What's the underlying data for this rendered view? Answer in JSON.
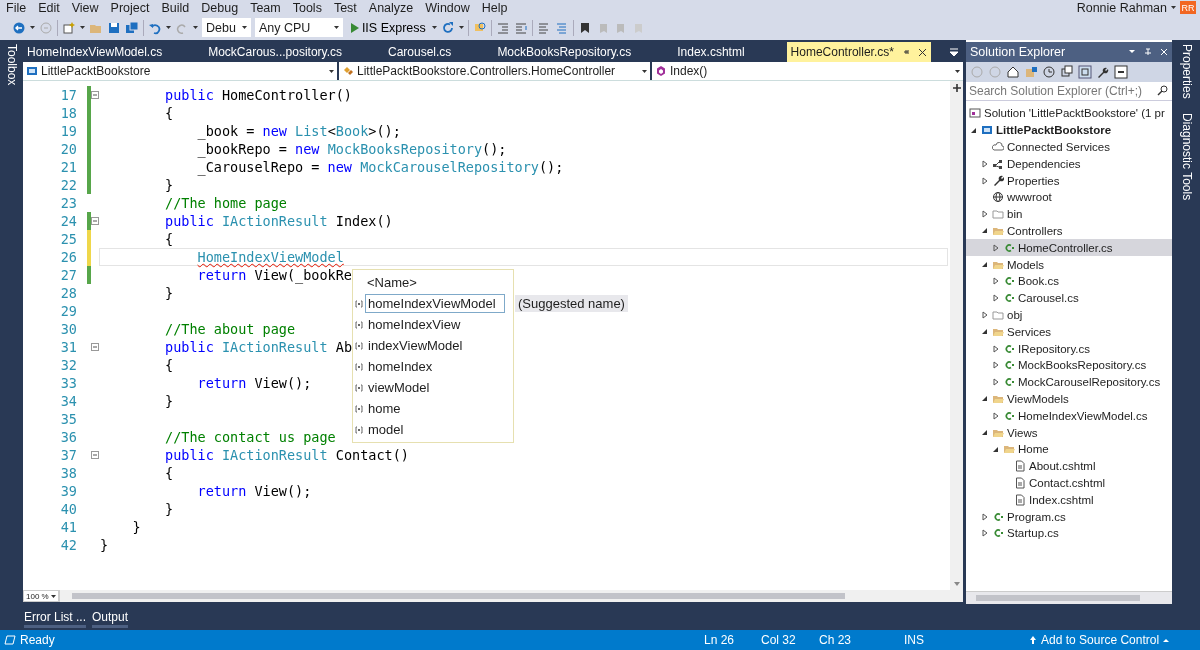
{
  "menu": [
    "File",
    "Edit",
    "View",
    "Project",
    "Build",
    "Debug",
    "Team",
    "Tools",
    "Test",
    "Analyze",
    "Window",
    "Help"
  ],
  "user": {
    "name": "Ronnie Rahman",
    "initials": "RR"
  },
  "toolbar": {
    "configuration": "Debu",
    "platform": "Any CPU",
    "run_target": "IIS Express"
  },
  "left_strip": [
    "Toolbox"
  ],
  "right_strip": [
    "Properties",
    "Diagnostic Tools"
  ],
  "tabs": [
    {
      "label": "HomeIndexViewModel.cs",
      "selected": false
    },
    {
      "label": "MockCarous...pository.cs",
      "selected": false
    },
    {
      "label": "Carousel.cs",
      "selected": false
    },
    {
      "label": "MockBooksRepository.cs",
      "selected": false
    },
    {
      "label": "Index.cshtml",
      "selected": false
    },
    {
      "label": "HomeController.cs*",
      "selected": true
    }
  ],
  "navigation": {
    "project": "LittlePacktBookstore",
    "type": "LittlePacktBookstore.Controllers.HomeController",
    "member": "Index()"
  },
  "code": {
    "lines": [
      {
        "number": "17",
        "color": "#57a64a",
        "fold": true,
        "current": false,
        "tokens": [
          {
            "kind": "keyword",
            "text": "        public"
          },
          {
            "kind": "plain",
            "text": " HomeController()"
          }
        ]
      },
      {
        "number": "18",
        "color": "#57a64a",
        "fold": false,
        "current": false,
        "tokens": [
          {
            "kind": "plain",
            "text": "        {"
          }
        ]
      },
      {
        "number": "19",
        "color": "#57a64a",
        "fold": false,
        "current": false,
        "tokens": [
          {
            "kind": "plain",
            "text": "            _book = "
          },
          {
            "kind": "keyword",
            "text": "new"
          },
          {
            "kind": "type",
            "text": " List"
          },
          {
            "kind": "plain",
            "text": "<"
          },
          {
            "kind": "type",
            "text": "Book"
          },
          {
            "kind": "plain",
            "text": ">();"
          }
        ]
      },
      {
        "number": "20",
        "color": "#57a64a",
        "fold": false,
        "current": false,
        "tokens": [
          {
            "kind": "plain",
            "text": "            _bookRepo = "
          },
          {
            "kind": "keyword",
            "text": "new"
          },
          {
            "kind": "type",
            "text": " MockBooksRepository"
          },
          {
            "kind": "plain",
            "text": "();"
          }
        ]
      },
      {
        "number": "21",
        "color": "#57a64a",
        "fold": false,
        "current": false,
        "tokens": [
          {
            "kind": "plain",
            "text": "            _CarouselRepo = "
          },
          {
            "kind": "keyword",
            "text": "new"
          },
          {
            "kind": "type",
            "text": " MockCarouselRepository"
          },
          {
            "kind": "plain",
            "text": "();"
          }
        ]
      },
      {
        "number": "22",
        "color": "#57a64a",
        "fold": false,
        "current": false,
        "tokens": [
          {
            "kind": "plain",
            "text": "        }"
          }
        ]
      },
      {
        "number": "23",
        "fold": false,
        "current": false,
        "tokens": [
          {
            "kind": "comment",
            "text": "        //The home page"
          }
        ]
      },
      {
        "number": "24",
        "color": "#57a64a",
        "fold": true,
        "current": false,
        "tokens": [
          {
            "kind": "keyword",
            "text": "        public"
          },
          {
            "kind": "type",
            "text": " IActionResult"
          },
          {
            "kind": "plain",
            "text": " Index()"
          }
        ]
      },
      {
        "number": "25",
        "color": "#efd74a",
        "fold": false,
        "current": false,
        "tokens": [
          {
            "kind": "plain",
            "text": "        {"
          }
        ]
      },
      {
        "number": "26",
        "color": "#efd74a",
        "fold": false,
        "current": true,
        "tokens": [
          {
            "kind": "type",
            "text": "            HomeIndexViewModel",
            "squiggle": true
          }
        ]
      },
      {
        "number": "27",
        "color": "#57a64a",
        "fold": false,
        "current": false,
        "tokens": [
          {
            "kind": "keyword",
            "text": "            return"
          },
          {
            "kind": "plain",
            "text": " View(_bookRe"
          }
        ]
      },
      {
        "number": "28",
        "fold": false,
        "current": false,
        "tokens": [
          {
            "kind": "plain",
            "text": "        }"
          }
        ]
      },
      {
        "number": "29",
        "fold": false,
        "current": false
      },
      {
        "number": "30",
        "fold": false,
        "current": false,
        "tokens": [
          {
            "kind": "comment",
            "text": "        //The about page"
          }
        ]
      },
      {
        "number": "31",
        "fold": true,
        "current": false,
        "tokens": [
          {
            "kind": "keyword",
            "text": "        public"
          },
          {
            "kind": "type",
            "text": " IActionResult"
          },
          {
            "kind": "plain",
            "text": " Ab"
          }
        ]
      },
      {
        "number": "32",
        "fold": false,
        "current": false,
        "tokens": [
          {
            "kind": "plain",
            "text": "        {"
          }
        ]
      },
      {
        "number": "33",
        "fold": false,
        "current": false,
        "tokens": [
          {
            "kind": "keyword",
            "text": "            return"
          },
          {
            "kind": "plain",
            "text": " View();"
          }
        ]
      },
      {
        "number": "34",
        "fold": false,
        "current": false,
        "tokens": [
          {
            "kind": "plain",
            "text": "        }"
          }
        ]
      },
      {
        "number": "35",
        "fold": false,
        "current": false
      },
      {
        "number": "36",
        "fold": false,
        "current": false,
        "tokens": [
          {
            "kind": "comment",
            "text": "        //The contact us page"
          }
        ]
      },
      {
        "number": "37",
        "fold": true,
        "current": false,
        "tokens": [
          {
            "kind": "keyword",
            "text": "        public"
          },
          {
            "kind": "type",
            "text": " IActionResult"
          },
          {
            "kind": "plain",
            "text": " Contact()"
          }
        ]
      },
      {
        "number": "38",
        "fold": false,
        "current": false,
        "tokens": [
          {
            "kind": "plain",
            "text": "        {"
          }
        ]
      },
      {
        "number": "39",
        "fold": false,
        "current": false,
        "tokens": [
          {
            "kind": "keyword",
            "text": "            return"
          },
          {
            "kind": "plain",
            "text": " View();"
          }
        ]
      },
      {
        "number": "40",
        "fold": false,
        "current": false,
        "tokens": [
          {
            "kind": "plain",
            "text": "        }"
          }
        ]
      },
      {
        "number": "41",
        "fold": false,
        "current": false,
        "tokens": [
          {
            "kind": "plain",
            "text": "    }"
          }
        ]
      },
      {
        "number": "42",
        "fold": false,
        "current": false,
        "tokens": [
          {
            "kind": "plain",
            "text": "}"
          }
        ]
      }
    ]
  },
  "completion": {
    "header": "<Name>",
    "hint": "(Suggested name)",
    "items": [
      {
        "text": "homeIndexViewModel",
        "selected": true
      },
      {
        "text": "homeIndexView",
        "selected": false
      },
      {
        "text": "indexViewModel",
        "selected": false
      },
      {
        "text": "homeIndex",
        "selected": false
      },
      {
        "text": "viewModel",
        "selected": false
      },
      {
        "text": "home",
        "selected": false
      },
      {
        "text": "model",
        "selected": false
      }
    ]
  },
  "zoom": "100 %",
  "solution_explorer": {
    "title": "Solution Explorer",
    "search": {
      "placeholder": "Search Solution Explorer (Ctrl+;)"
    },
    "tree": [
      {
        "label": "Solution 'LittlePacktBookstore' (1 pr",
        "kind": "solution",
        "selected": false,
        "children": [
          {
            "label": "LittlePacktBookstore",
            "kind": "project",
            "expanded": true,
            "selected": false,
            "children": [
              {
                "label": "Connected Services",
                "kind": "connected",
                "selected": false
              },
              {
                "label": "Dependencies",
                "kind": "dependencies",
                "expanded": false,
                "selected": false
              },
              {
                "label": "Properties",
                "kind": "properties",
                "expanded": false,
                "selected": false
              },
              {
                "label": "wwwroot",
                "kind": "web",
                "selected": false
              },
              {
                "label": "bin",
                "kind": "hidden-folder",
                "expanded": false,
                "selected": false
              },
              {
                "label": "Controllers",
                "kind": "folder",
                "expanded": true,
                "selected": false,
                "children": [
                  {
                    "label": "HomeController.cs",
                    "kind": "cs",
                    "expanded": false,
                    "selected": true
                  }
                ]
              },
              {
                "label": "Models",
                "kind": "folder",
                "expanded": true,
                "selected": false,
                "children": [
                  {
                    "label": "Book.cs",
                    "kind": "cs",
                    "expanded": false,
                    "selected": false
                  },
                  {
                    "label": "Carousel.cs",
                    "kind": "cs",
                    "expanded": false,
                    "selected": false
                  }
                ]
              },
              {
                "label": "obj",
                "kind": "hidden-folder",
                "expanded": false,
                "selected": false
              },
              {
                "label": "Services",
                "kind": "folder",
                "expanded": true,
                "selected": false,
                "children": [
                  {
                    "label": "IRepository.cs",
                    "kind": "cs",
                    "expanded": false,
                    "selected": false
                  },
                  {
                    "label": "MockBooksRepository.cs",
                    "kind": "cs",
                    "expanded": false,
                    "selected": false
                  },
                  {
                    "label": "MockCarouselRepository.cs",
                    "kind": "cs",
                    "expanded": false,
                    "selected": false
                  }
                ]
              },
              {
                "label": "ViewModels",
                "kind": "folder",
                "expanded": true,
                "selected": false,
                "children": [
                  {
                    "label": "HomeIndexViewModel.cs",
                    "kind": "cs",
                    "expanded": false,
                    "selected": false
                  }
                ]
              },
              {
                "label": "Views",
                "kind": "folder",
                "expanded": true,
                "selected": false,
                "children": [
                  {
                    "label": "Home",
                    "kind": "folder",
                    "expanded": true,
                    "selected": false,
                    "children": [
                      {
                        "label": "About.cshtml",
                        "kind": "page",
                        "selected": false
                      },
                      {
                        "label": "Contact.cshtml",
                        "kind": "page",
                        "selected": false
                      },
                      {
                        "label": "Index.cshtml",
                        "kind": "page",
                        "selected": false
                      }
                    ]
                  }
                ]
              },
              {
                "label": "Program.cs",
                "kind": "cs",
                "expanded": false,
                "selected": false
              },
              {
                "label": "Startup.cs",
                "kind": "cs",
                "expanded": false,
                "selected": false
              }
            ]
          }
        ]
      }
    ]
  },
  "bottom_tabs": [
    "Error List ...",
    "Output"
  ],
  "status_bar": {
    "message": "Ready",
    "line": "Ln 26",
    "column": "Col 32",
    "char": "Ch 23",
    "mode": "INS",
    "source_control": "Add to Source Control"
  }
}
